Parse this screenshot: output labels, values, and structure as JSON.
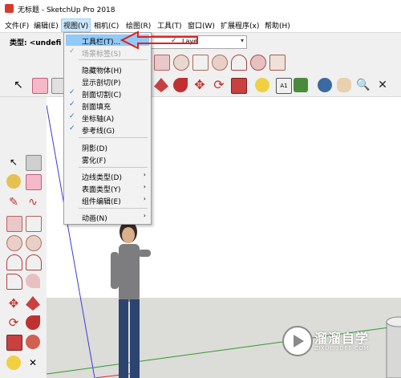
{
  "window": {
    "title": "无标题 - SketchUp Pro 2018"
  },
  "menubar": {
    "items": [
      "文件(F)",
      "编辑(E)",
      "视图(V)",
      "相机(C)",
      "绘图(R)",
      "工具(T)",
      "窗口(W)",
      "扩展程序(x)",
      "帮助(H)"
    ]
  },
  "typebar": {
    "label": "类型: <undefi",
    "layer_name": "Laye"
  },
  "view_menu": {
    "items": [
      {
        "label": "工具栏(T)...",
        "checked": false,
        "disabled": false,
        "submenu": false,
        "highlighted": true
      },
      {
        "label": "场景标签(S)",
        "checked": true,
        "disabled": true,
        "submenu": false,
        "highlighted": false
      },
      {
        "label": "隐藏物体(H)",
        "checked": false,
        "disabled": false,
        "submenu": false,
        "highlighted": false
      },
      {
        "label": "显示剖切(P)",
        "checked": false,
        "disabled": false,
        "submenu": false,
        "highlighted": false
      },
      {
        "label": "剖面切割(C)",
        "checked": true,
        "disabled": false,
        "submenu": false,
        "highlighted": false
      },
      {
        "label": "剖面填充",
        "checked": true,
        "disabled": false,
        "submenu": false,
        "highlighted": false
      },
      {
        "label": "坐标轴(A)",
        "checked": true,
        "disabled": false,
        "submenu": false,
        "highlighted": false
      },
      {
        "label": "参考线(G)",
        "checked": true,
        "disabled": false,
        "submenu": false,
        "highlighted": false
      },
      {
        "label": "阴影(D)",
        "checked": false,
        "disabled": false,
        "submenu": false,
        "highlighted": false
      },
      {
        "label": "雾化(F)",
        "checked": false,
        "disabled": false,
        "submenu": false,
        "highlighted": false
      },
      {
        "label": "边线类型(D)",
        "checked": false,
        "disabled": false,
        "submenu": true,
        "highlighted": false
      },
      {
        "label": "表面类型(Y)",
        "checked": false,
        "disabled": false,
        "submenu": true,
        "highlighted": false
      },
      {
        "label": "组件编辑(E)",
        "checked": false,
        "disabled": false,
        "submenu": true,
        "highlighted": false
      },
      {
        "label": "动画(N)",
        "checked": false,
        "disabled": false,
        "submenu": true,
        "highlighted": false
      }
    ],
    "check_glyph": "✓",
    "submenu_glyph": "›"
  },
  "toolbar3": {
    "text_tool_label": "A1"
  },
  "watermark": {
    "title": "溜溜自学",
    "url": "ZIXUE.3D66.COM"
  },
  "colors": {
    "accent_red": "#e02020",
    "menu_highlight": "#91c9f7",
    "axis_green": "#2e9b2e",
    "axis_blue": "#3b3bd6",
    "axis_red": "#d23030"
  }
}
